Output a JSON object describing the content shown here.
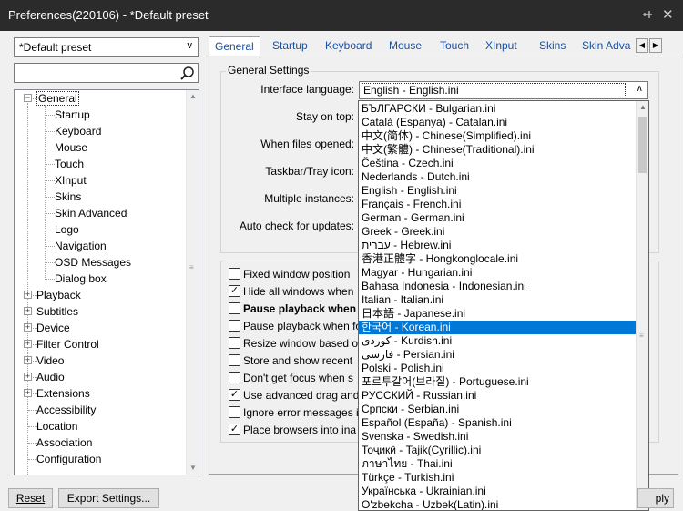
{
  "window": {
    "title": "Preferences(220106) - *Default preset",
    "pin_icon": "pin-icon",
    "close_icon": "close-icon"
  },
  "preset": {
    "value": "*Default preset"
  },
  "search": {
    "placeholder": ""
  },
  "tree": {
    "items": [
      {
        "label": "General",
        "level": 0,
        "expander": "minus",
        "selected": true
      },
      {
        "label": "Startup",
        "level": 1
      },
      {
        "label": "Keyboard",
        "level": 1
      },
      {
        "label": "Mouse",
        "level": 1
      },
      {
        "label": "Touch",
        "level": 1
      },
      {
        "label": "XInput",
        "level": 1
      },
      {
        "label": "Skins",
        "level": 1
      },
      {
        "label": "Skin Advanced",
        "level": 1
      },
      {
        "label": "Logo",
        "level": 1
      },
      {
        "label": "Navigation",
        "level": 1
      },
      {
        "label": "OSD Messages",
        "level": 1
      },
      {
        "label": "Dialog box",
        "level": 1
      },
      {
        "label": "Playback",
        "level": 0,
        "expander": "plus"
      },
      {
        "label": "Subtitles",
        "level": 0,
        "expander": "plus"
      },
      {
        "label": "Device",
        "level": 0,
        "expander": "plus"
      },
      {
        "label": "Filter Control",
        "level": 0,
        "expander": "plus"
      },
      {
        "label": "Video",
        "level": 0,
        "expander": "plus"
      },
      {
        "label": "Audio",
        "level": 0,
        "expander": "plus"
      },
      {
        "label": "Extensions",
        "level": 0,
        "expander": "plus"
      },
      {
        "label": "Accessibility",
        "level": 0
      },
      {
        "label": "Location",
        "level": 0
      },
      {
        "label": "Association",
        "level": 0
      },
      {
        "label": "Configuration",
        "level": 0
      }
    ]
  },
  "tabs": [
    {
      "label": "General",
      "active": true
    },
    {
      "label": "Startup"
    },
    {
      "label": "Keyboard"
    },
    {
      "label": "Mouse"
    },
    {
      "label": "Touch"
    },
    {
      "label": "XInput"
    },
    {
      "label": "Skins"
    },
    {
      "label": "Skin Adva"
    }
  ],
  "general": {
    "group_label": "General Settings",
    "interface_language_label": "Interface language:",
    "interface_language_value": "English - English.ini",
    "stay_on_top_label": "Stay on top:",
    "when_files_opened_label": "When files opened:",
    "taskbar_tray_label": "Taskbar/Tray icon:",
    "multiple_instances_label": "Multiple instances:",
    "auto_check_label": "Auto check for updates:"
  },
  "checkboxes": [
    {
      "label": "Fixed window position",
      "checked": false
    },
    {
      "label": "Hide all windows when",
      "checked": true
    },
    {
      "label": "Pause playback when",
      "checked": false,
      "bold": true
    },
    {
      "label": "Pause playback when fo",
      "checked": false
    },
    {
      "label": "Resize window based o",
      "checked": false
    },
    {
      "label": "Store and show recent",
      "checked": false
    },
    {
      "label": "Don't get focus when s",
      "checked": false
    },
    {
      "label": "Use advanced drag and",
      "checked": true
    },
    {
      "label": "Ignore error messages i",
      "checked": false
    },
    {
      "label": "Place browsers into ina",
      "checked": true
    }
  ],
  "languages": [
    "БЪЛГАРСКИ - Bulgarian.ini",
    "Català (Espanya) - Catalan.ini",
    "中文(简体) - Chinese(Simplified).ini",
    "中文(繁體) - Chinese(Traditional).ini",
    "Čeština - Czech.ini",
    "Nederlands - Dutch.ini",
    "English - English.ini",
    "Français - French.ini",
    "German - German.ini",
    "Greek - Greek.ini",
    "עברית - Hebrew.ini",
    "香港正體字 - Hongkonglocale.ini",
    "Magyar - Hungarian.ini",
    "Bahasa Indonesia - Indonesian.ini",
    "Italian - Italian.ini",
    "日本語 - Japanese.ini",
    "한국어 - Korean.ini",
    "کوردی - Kurdish.ini",
    "فارسی - Persian.ini",
    "Polski - Polish.ini",
    "포르투갈어(브라질) - Portuguese.ini",
    "РУССКИЙ - Russian.ini",
    "Српски - Serbian.ini",
    "Español (España) - Spanish.ini",
    "Svenska - Swedish.ini",
    "Тоҷикӣ - Tajik(Cyrillic).ini",
    "ภาษาไทย - Thai.ini",
    "Türkçe - Turkish.ini",
    "Українська - Ukrainian.ini",
    "O'zbekcha - Uzbek(Latin).ini"
  ],
  "selected_language": "한국어 - Korean.ini",
  "buttons": {
    "reset": "Reset",
    "export": "Export Settings...",
    "apply_partial": "ply"
  }
}
